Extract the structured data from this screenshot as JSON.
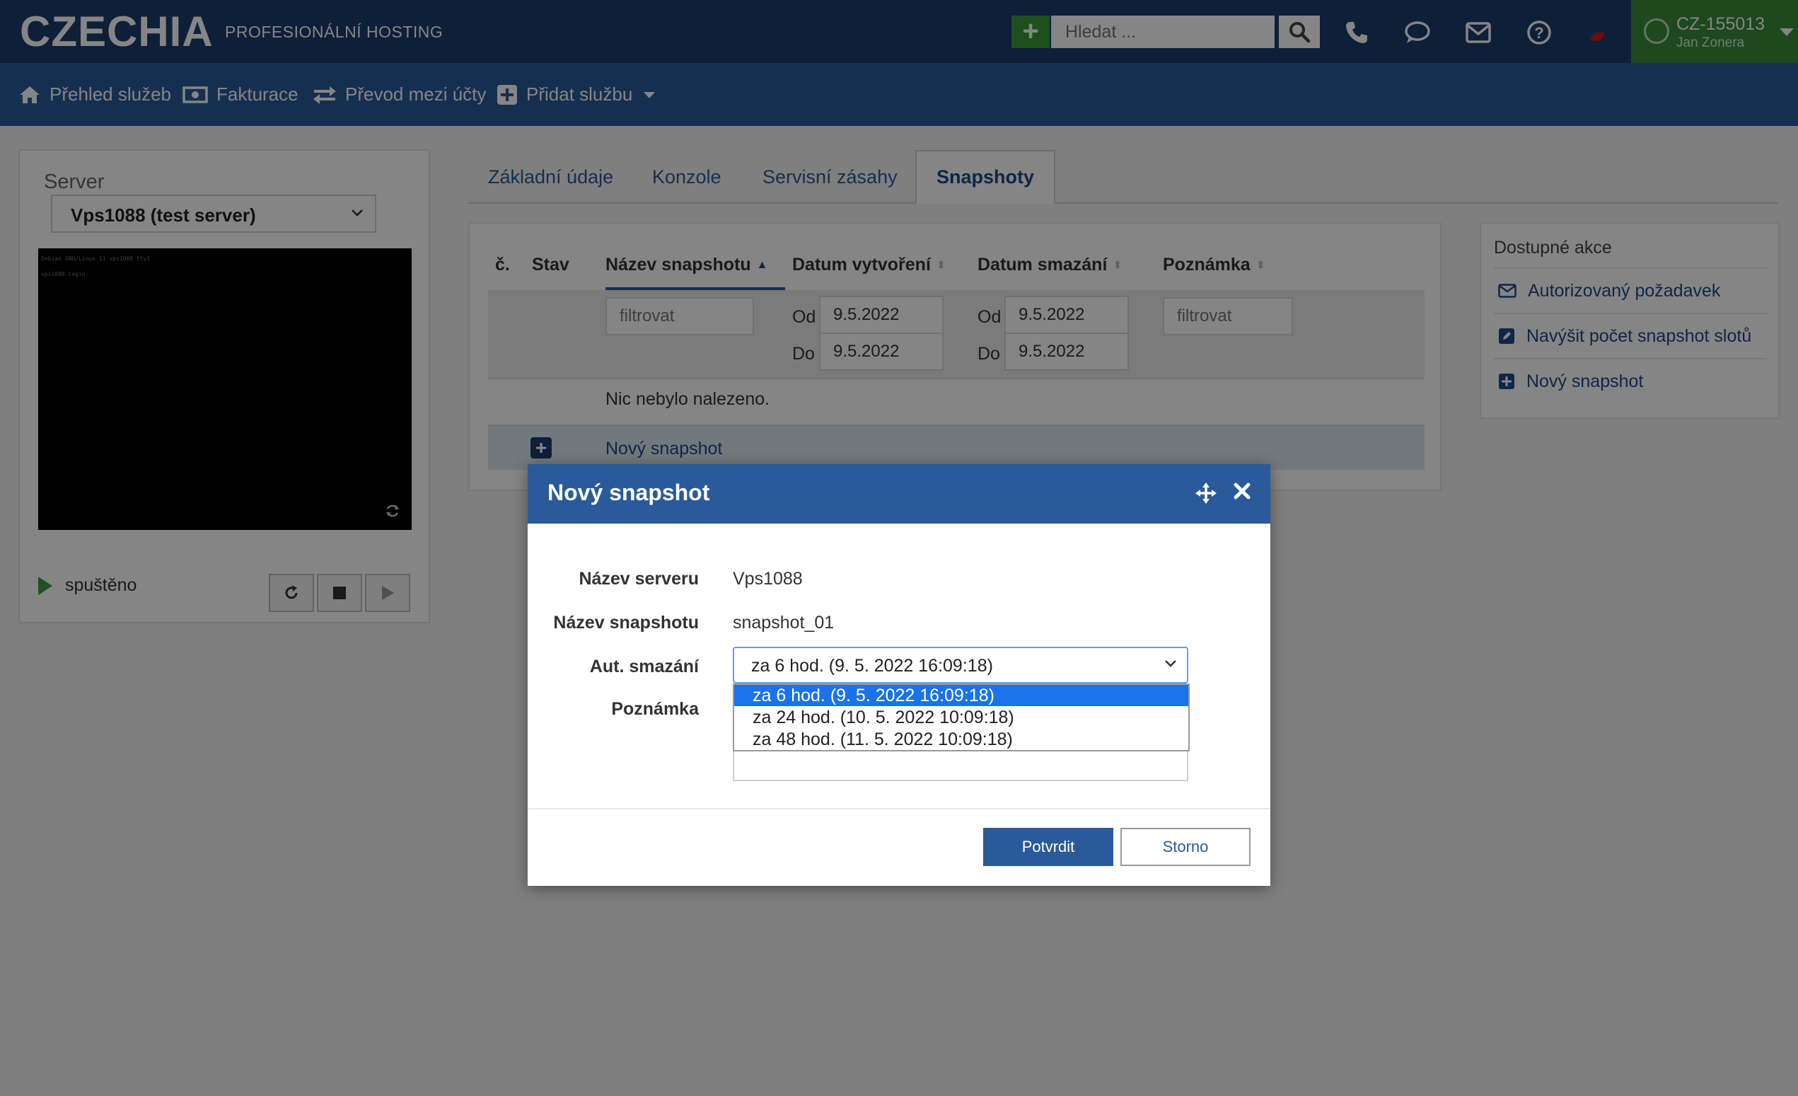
{
  "header": {
    "logo": "CZECHIA",
    "tagline": "PROFESIONÁLNÍ HOSTING",
    "add_icon": "plus-icon",
    "search_placeholder": "Hledat ...",
    "icons": [
      "search-icon",
      "phone-icon",
      "chat-icon",
      "mail-icon",
      "help-icon",
      "flag-icon"
    ],
    "account": {
      "id": "CZ-155013",
      "name": "Jan Zonera"
    }
  },
  "nav": {
    "items": [
      {
        "label": "Přehled služeb",
        "icon": "home-icon"
      },
      {
        "label": "Fakturace",
        "icon": "money-icon"
      },
      {
        "label": "Převod mezi účty",
        "icon": "transfer-icon"
      },
      {
        "label": "Přidat službu",
        "icon": "plus-square-icon"
      }
    ]
  },
  "server": {
    "label": "Server",
    "selected": "Vps1088 (test server)",
    "console_lines": [
      "Debian GNU/Linux 11 vps1088 tty1",
      "vps1088 login:"
    ],
    "status": "spuštěno"
  },
  "tabs": [
    "Základní údaje",
    "Konzole",
    "Servisní zásahy",
    "Snapshoty"
  ],
  "active_tab": "Snapshoty",
  "table": {
    "columns": [
      "č.",
      "Stav",
      "Název snapshotu",
      "Datum vytvoření",
      "Datum smazání",
      "Poznámka"
    ],
    "filter_placeholder": "filtrovat",
    "from_label": "Od",
    "to_label": "Do",
    "created_from": "9.5.2022",
    "created_to": "9.5.2022",
    "deleted_from": "9.5.2022",
    "deleted_to": "9.5.2022",
    "empty_message": "Nic nebylo nalezeno.",
    "new_row_label": "Nový snapshot"
  },
  "actions": {
    "title": "Dostupné akce",
    "items": [
      {
        "label": "Autorizovaný požadavek",
        "icon": "envelope-icon"
      },
      {
        "label": "Navýšit počet snapshot slotů",
        "icon": "edit-icon"
      },
      {
        "label": "Nový snapshot",
        "icon": "plus-square-icon"
      }
    ]
  },
  "modal": {
    "title": "Nový snapshot",
    "server_name_label": "Název serveru",
    "server_name_value": "Vps1088",
    "snapshot_name_label": "Název snapshotu",
    "snapshot_name_value": "snapshot_01",
    "auto_delete_label": "Aut. smazání",
    "auto_delete_selected": "za 6 hod. (9. 5. 2022 16:09:18)",
    "auto_delete_options": [
      "za 6 hod. (9. 5. 2022 16:09:18)",
      "za 24 hod. (10. 5. 2022 10:09:18)",
      "za 48 hod. (11. 5. 2022 10:09:18)"
    ],
    "note_label": "Poznámka",
    "confirm_label": "Potvrdit",
    "cancel_label": "Storno"
  },
  "colors": {
    "header_bg": "#1c3d6b",
    "nav_bg": "#2a5a9a",
    "account_bg": "#3a8a3a",
    "add_bg": "#3a9a3a",
    "selected_option": "#1a73e8"
  }
}
